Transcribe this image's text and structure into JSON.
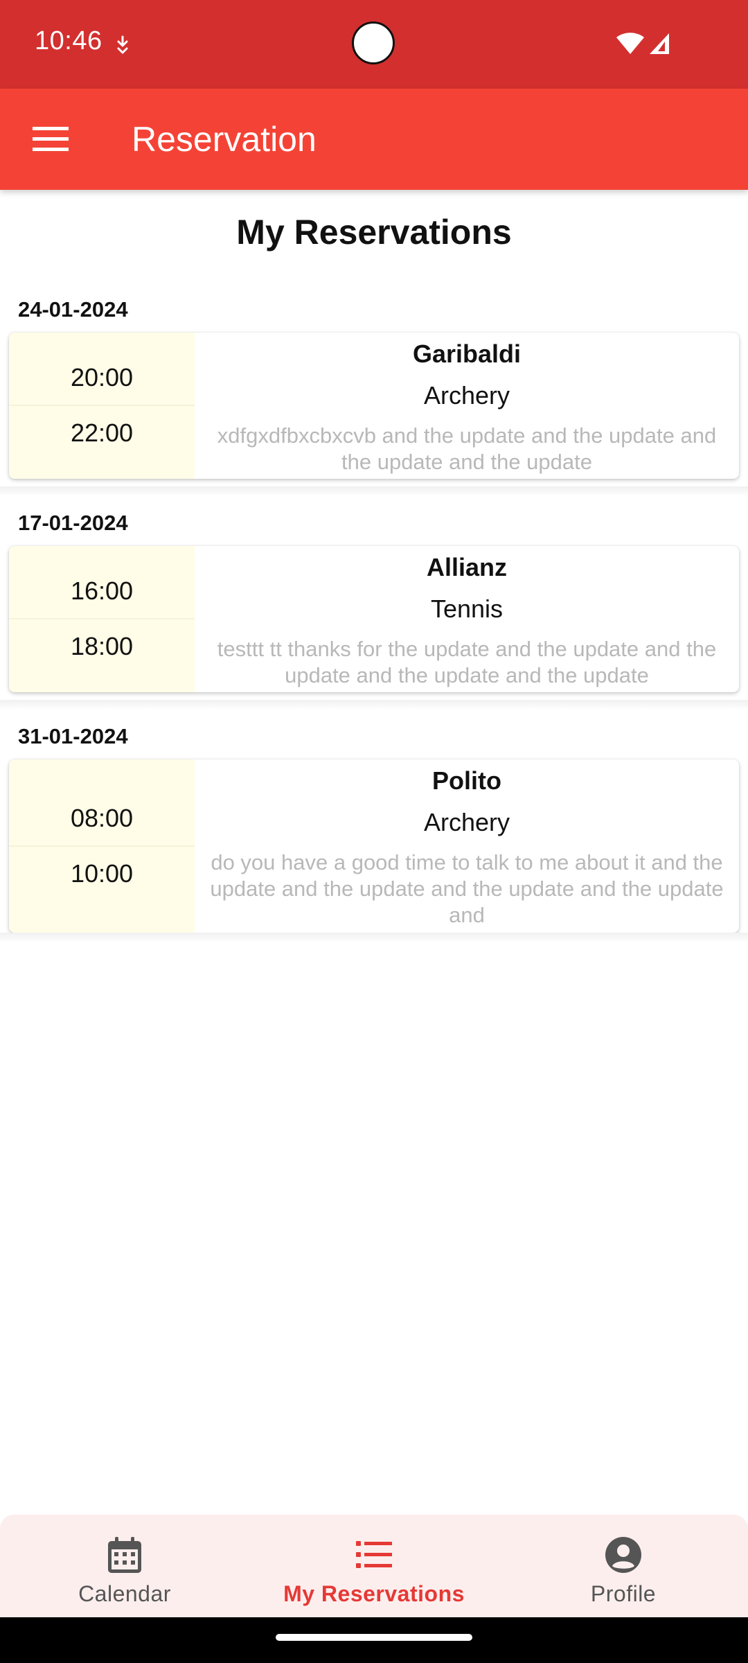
{
  "status_bar": {
    "time": "10:46",
    "icons": [
      "download-indicator-icon",
      "wifi-icon",
      "signal-icon"
    ]
  },
  "app_bar": {
    "title": "Reservation",
    "menu_icon": "hamburger-menu-icon",
    "color": "#f44336"
  },
  "page": {
    "heading": "My Reservations"
  },
  "reservations": [
    {
      "date": "24-01-2024",
      "start": "20:00",
      "end": "22:00",
      "venue": "Garibaldi",
      "sport": "Archery",
      "note": "xdfgxdfbxcbxcvb and the update and the update and the update and the update"
    },
    {
      "date": "17-01-2024",
      "start": "16:00",
      "end": "18:00",
      "venue": "Allianz",
      "sport": "Tennis",
      "note": "testtt tt thanks for the update and the update and the update and the update and the update"
    },
    {
      "date": "31-01-2024",
      "start": "08:00",
      "end": "10:00",
      "venue": "Polito",
      "sport": "Archery",
      "note": "do you have a good time to talk to me about it and the update and the update and the update and the update and"
    }
  ],
  "bottom_nav": {
    "items": [
      {
        "label": "Calendar",
        "icon": "calendar-icon",
        "active": false
      },
      {
        "label": "My Reservations",
        "icon": "list-icon",
        "active": true
      },
      {
        "label": "Profile",
        "icon": "account-circle-icon",
        "active": false
      }
    ],
    "active_color": "#e53935"
  }
}
